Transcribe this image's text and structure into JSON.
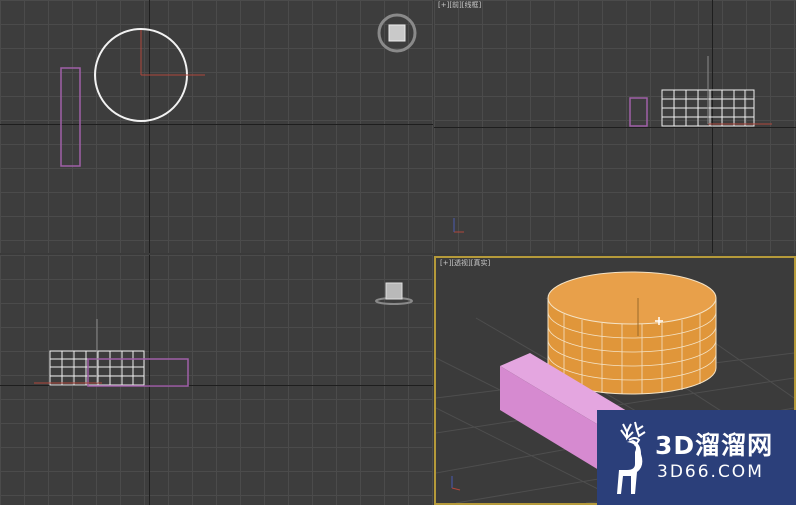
{
  "viewports": {
    "top_left": {
      "label": ""
    },
    "top_right": {
      "label": "[+][前][线框]"
    },
    "bottom_left": {
      "label": ""
    },
    "bottom_right": {
      "label": "[+][透视][真实]"
    }
  },
  "watermark": {
    "brand_cn": "3D溜溜网",
    "brand_en": "3D66.COM",
    "logo_icon": "deer-icon"
  },
  "colors": {
    "selected_viewport_border": "#b59a3a",
    "cylinder_fill": "#e39a3a",
    "box_fill": "#d98fd3",
    "watermark_bg": "#2b3f7a"
  }
}
